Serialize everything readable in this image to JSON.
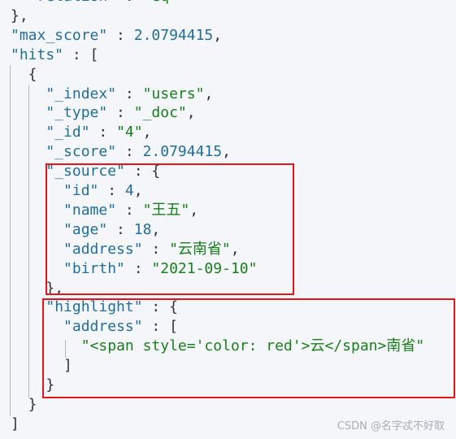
{
  "json_lines": [
    {
      "indent": 2,
      "tokens": [
        [
          "k",
          "\"relation\""
        ],
        [
          "p",
          " : "
        ],
        [
          "s",
          "\"eq\""
        ]
      ]
    },
    {
      "indent": 0,
      "tokens": [
        [
          "p",
          "},"
        ]
      ]
    },
    {
      "indent": 0,
      "tokens": [
        [
          "k",
          "\"max_score\""
        ],
        [
          "p",
          " : "
        ],
        [
          "n",
          "2.0794415"
        ],
        [
          "p",
          ","
        ]
      ]
    },
    {
      "indent": 0,
      "tokens": [
        [
          "k",
          "\"hits\""
        ],
        [
          "p",
          " : ["
        ]
      ]
    },
    {
      "indent": 2,
      "tokens": [
        [
          "p",
          "{"
        ]
      ]
    },
    {
      "indent": 4,
      "tokens": [
        [
          "k",
          "\"_index\""
        ],
        [
          "p",
          " : "
        ],
        [
          "s",
          "\"users\""
        ],
        [
          "p",
          ","
        ]
      ]
    },
    {
      "indent": 4,
      "tokens": [
        [
          "k",
          "\"_type\""
        ],
        [
          "p",
          " : "
        ],
        [
          "s",
          "\"_doc\""
        ],
        [
          "p",
          ","
        ]
      ]
    },
    {
      "indent": 4,
      "tokens": [
        [
          "k",
          "\"_id\""
        ],
        [
          "p",
          " : "
        ],
        [
          "s",
          "\"4\""
        ],
        [
          "p",
          ","
        ]
      ]
    },
    {
      "indent": 4,
      "tokens": [
        [
          "k",
          "\"_score\""
        ],
        [
          "p",
          " : "
        ],
        [
          "n",
          "2.0794415"
        ],
        [
          "p",
          ","
        ]
      ]
    },
    {
      "indent": 4,
      "tokens": [
        [
          "k",
          "\"_source\""
        ],
        [
          "p",
          " : {"
        ]
      ]
    },
    {
      "indent": 6,
      "tokens": [
        [
          "k",
          "\"id\""
        ],
        [
          "p",
          " : "
        ],
        [
          "n",
          "4"
        ],
        [
          "p",
          ","
        ]
      ]
    },
    {
      "indent": 6,
      "tokens": [
        [
          "k",
          "\"name\""
        ],
        [
          "p",
          " : "
        ],
        [
          "s",
          "\"王五\""
        ],
        [
          "p",
          ","
        ]
      ]
    },
    {
      "indent": 6,
      "tokens": [
        [
          "k",
          "\"age\""
        ],
        [
          "p",
          " : "
        ],
        [
          "n",
          "18"
        ],
        [
          "p",
          ","
        ]
      ]
    },
    {
      "indent": 6,
      "tokens": [
        [
          "k",
          "\"address\""
        ],
        [
          "p",
          " : "
        ],
        [
          "s",
          "\"云南省\""
        ],
        [
          "p",
          ","
        ]
      ]
    },
    {
      "indent": 6,
      "tokens": [
        [
          "k",
          "\"birth\""
        ],
        [
          "p",
          " : "
        ],
        [
          "s",
          "\"2021-09-10\""
        ]
      ]
    },
    {
      "indent": 4,
      "tokens": [
        [
          "p",
          "},"
        ]
      ]
    },
    {
      "indent": 4,
      "tokens": [
        [
          "k",
          "\"highlight\""
        ],
        [
          "p",
          " : {"
        ]
      ]
    },
    {
      "indent": 6,
      "tokens": [
        [
          "k",
          "\"address\""
        ],
        [
          "p",
          " : ["
        ]
      ]
    },
    {
      "indent": 8,
      "tokens": [
        [
          "s",
          "\"<span style='color: red'>云</span>南省\""
        ]
      ]
    },
    {
      "indent": 6,
      "tokens": [
        [
          "p",
          "]"
        ]
      ]
    },
    {
      "indent": 4,
      "tokens": [
        [
          "p",
          "}"
        ]
      ]
    },
    {
      "indent": 2,
      "tokens": [
        [
          "p",
          "}"
        ]
      ]
    },
    {
      "indent": 0,
      "tokens": [
        [
          "p",
          "]"
        ]
      ]
    }
  ],
  "watermark": "CSDN @名字忒不好取",
  "colors": {
    "key": "#1f6e9c",
    "string": "#17801a",
    "number": "#1f6e9c",
    "highlight_box": "#e8141c",
    "background": "#f5f6fa"
  }
}
